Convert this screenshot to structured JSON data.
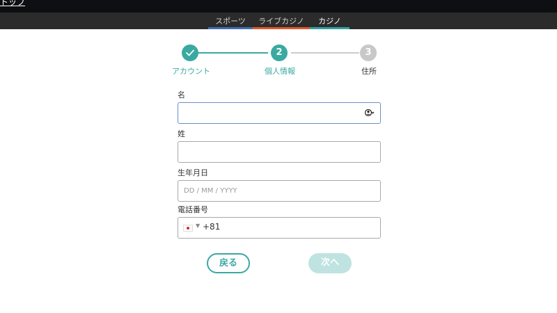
{
  "topbar": {
    "link_label": "トップ"
  },
  "nav": {
    "tabs": [
      {
        "label": "スポーツ"
      },
      {
        "label": "ライブカジノ"
      },
      {
        "label": "カジノ"
      }
    ]
  },
  "stepper": {
    "steps": [
      {
        "number": "1",
        "label": "アカウント",
        "state": "completed"
      },
      {
        "number": "2",
        "label": "個人情報",
        "state": "current"
      },
      {
        "number": "3",
        "label": "住所",
        "state": "upcoming"
      }
    ],
    "check_icon": "check-icon"
  },
  "form": {
    "first_name": {
      "label": "名",
      "value": "",
      "placeholder": ""
    },
    "last_name": {
      "label": "姓",
      "value": "",
      "placeholder": ""
    },
    "birthdate": {
      "label": "生年月日",
      "value": "",
      "placeholder": "DD / MM / YYYY"
    },
    "phone": {
      "label": "電話番号",
      "country_flag": "japan-flag-icon",
      "prefix": "+81",
      "value": ""
    }
  },
  "buttons": {
    "back_label": "戻る",
    "next_label": "次へ"
  },
  "colors": {
    "accent": "#3aa9a1",
    "sports_tab": "#3d6fb4",
    "live_casino_tab": "#e3562a",
    "casino_tab": "#2fa39e",
    "disabled_button": "#bfe3e0"
  }
}
